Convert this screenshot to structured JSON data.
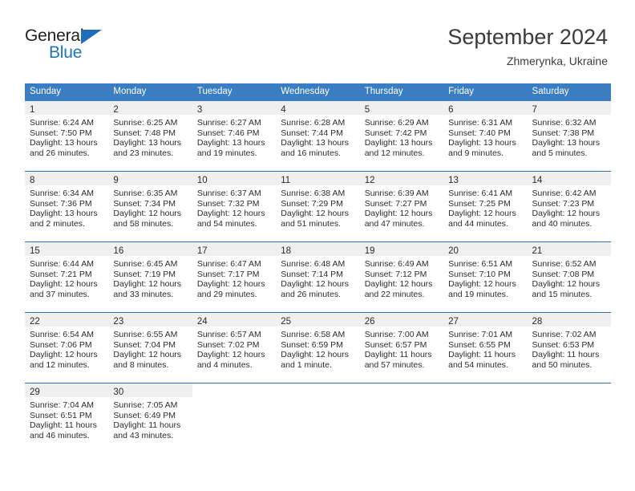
{
  "brand": {
    "name_top": "General",
    "name_bottom": "Blue",
    "accent_color": "#1b75bb",
    "triangle_color": "#1e6fb8"
  },
  "header": {
    "title": "September 2024",
    "subtitle": "Zhmerynka, Ukraine"
  },
  "calendar": {
    "header_bg": "#3a7dc2",
    "row_divider_color": "#2f6fb4",
    "day_band_bg": "#efefef",
    "weekdays": [
      "Sunday",
      "Monday",
      "Tuesday",
      "Wednesday",
      "Thursday",
      "Friday",
      "Saturday"
    ],
    "weeks": [
      [
        {
          "day": "1",
          "sunrise": "Sunrise: 6:24 AM",
          "sunset": "Sunset: 7:50 PM",
          "daylight1": "Daylight: 13 hours",
          "daylight2": "and 26 minutes."
        },
        {
          "day": "2",
          "sunrise": "Sunrise: 6:25 AM",
          "sunset": "Sunset: 7:48 PM",
          "daylight1": "Daylight: 13 hours",
          "daylight2": "and 23 minutes."
        },
        {
          "day": "3",
          "sunrise": "Sunrise: 6:27 AM",
          "sunset": "Sunset: 7:46 PM",
          "daylight1": "Daylight: 13 hours",
          "daylight2": "and 19 minutes."
        },
        {
          "day": "4",
          "sunrise": "Sunrise: 6:28 AM",
          "sunset": "Sunset: 7:44 PM",
          "daylight1": "Daylight: 13 hours",
          "daylight2": "and 16 minutes."
        },
        {
          "day": "5",
          "sunrise": "Sunrise: 6:29 AM",
          "sunset": "Sunset: 7:42 PM",
          "daylight1": "Daylight: 13 hours",
          "daylight2": "and 12 minutes."
        },
        {
          "day": "6",
          "sunrise": "Sunrise: 6:31 AM",
          "sunset": "Sunset: 7:40 PM",
          "daylight1": "Daylight: 13 hours",
          "daylight2": "and 9 minutes."
        },
        {
          "day": "7",
          "sunrise": "Sunrise: 6:32 AM",
          "sunset": "Sunset: 7:38 PM",
          "daylight1": "Daylight: 13 hours",
          "daylight2": "and 5 minutes."
        }
      ],
      [
        {
          "day": "8",
          "sunrise": "Sunrise: 6:34 AM",
          "sunset": "Sunset: 7:36 PM",
          "daylight1": "Daylight: 13 hours",
          "daylight2": "and 2 minutes."
        },
        {
          "day": "9",
          "sunrise": "Sunrise: 6:35 AM",
          "sunset": "Sunset: 7:34 PM",
          "daylight1": "Daylight: 12 hours",
          "daylight2": "and 58 minutes."
        },
        {
          "day": "10",
          "sunrise": "Sunrise: 6:37 AM",
          "sunset": "Sunset: 7:32 PM",
          "daylight1": "Daylight: 12 hours",
          "daylight2": "and 54 minutes."
        },
        {
          "day": "11",
          "sunrise": "Sunrise: 6:38 AM",
          "sunset": "Sunset: 7:29 PM",
          "daylight1": "Daylight: 12 hours",
          "daylight2": "and 51 minutes."
        },
        {
          "day": "12",
          "sunrise": "Sunrise: 6:39 AM",
          "sunset": "Sunset: 7:27 PM",
          "daylight1": "Daylight: 12 hours",
          "daylight2": "and 47 minutes."
        },
        {
          "day": "13",
          "sunrise": "Sunrise: 6:41 AM",
          "sunset": "Sunset: 7:25 PM",
          "daylight1": "Daylight: 12 hours",
          "daylight2": "and 44 minutes."
        },
        {
          "day": "14",
          "sunrise": "Sunrise: 6:42 AM",
          "sunset": "Sunset: 7:23 PM",
          "daylight1": "Daylight: 12 hours",
          "daylight2": "and 40 minutes."
        }
      ],
      [
        {
          "day": "15",
          "sunrise": "Sunrise: 6:44 AM",
          "sunset": "Sunset: 7:21 PM",
          "daylight1": "Daylight: 12 hours",
          "daylight2": "and 37 minutes."
        },
        {
          "day": "16",
          "sunrise": "Sunrise: 6:45 AM",
          "sunset": "Sunset: 7:19 PM",
          "daylight1": "Daylight: 12 hours",
          "daylight2": "and 33 minutes."
        },
        {
          "day": "17",
          "sunrise": "Sunrise: 6:47 AM",
          "sunset": "Sunset: 7:17 PM",
          "daylight1": "Daylight: 12 hours",
          "daylight2": "and 29 minutes."
        },
        {
          "day": "18",
          "sunrise": "Sunrise: 6:48 AM",
          "sunset": "Sunset: 7:14 PM",
          "daylight1": "Daylight: 12 hours",
          "daylight2": "and 26 minutes."
        },
        {
          "day": "19",
          "sunrise": "Sunrise: 6:49 AM",
          "sunset": "Sunset: 7:12 PM",
          "daylight1": "Daylight: 12 hours",
          "daylight2": "and 22 minutes."
        },
        {
          "day": "20",
          "sunrise": "Sunrise: 6:51 AM",
          "sunset": "Sunset: 7:10 PM",
          "daylight1": "Daylight: 12 hours",
          "daylight2": "and 19 minutes."
        },
        {
          "day": "21",
          "sunrise": "Sunrise: 6:52 AM",
          "sunset": "Sunset: 7:08 PM",
          "daylight1": "Daylight: 12 hours",
          "daylight2": "and 15 minutes."
        }
      ],
      [
        {
          "day": "22",
          "sunrise": "Sunrise: 6:54 AM",
          "sunset": "Sunset: 7:06 PM",
          "daylight1": "Daylight: 12 hours",
          "daylight2": "and 12 minutes."
        },
        {
          "day": "23",
          "sunrise": "Sunrise: 6:55 AM",
          "sunset": "Sunset: 7:04 PM",
          "daylight1": "Daylight: 12 hours",
          "daylight2": "and 8 minutes."
        },
        {
          "day": "24",
          "sunrise": "Sunrise: 6:57 AM",
          "sunset": "Sunset: 7:02 PM",
          "daylight1": "Daylight: 12 hours",
          "daylight2": "and 4 minutes."
        },
        {
          "day": "25",
          "sunrise": "Sunrise: 6:58 AM",
          "sunset": "Sunset: 6:59 PM",
          "daylight1": "Daylight: 12 hours",
          "daylight2": "and 1 minute."
        },
        {
          "day": "26",
          "sunrise": "Sunrise: 7:00 AM",
          "sunset": "Sunset: 6:57 PM",
          "daylight1": "Daylight: 11 hours",
          "daylight2": "and 57 minutes."
        },
        {
          "day": "27",
          "sunrise": "Sunrise: 7:01 AM",
          "sunset": "Sunset: 6:55 PM",
          "daylight1": "Daylight: 11 hours",
          "daylight2": "and 54 minutes."
        },
        {
          "day": "28",
          "sunrise": "Sunrise: 7:02 AM",
          "sunset": "Sunset: 6:53 PM",
          "daylight1": "Daylight: 11 hours",
          "daylight2": "and 50 minutes."
        }
      ],
      [
        {
          "day": "29",
          "sunrise": "Sunrise: 7:04 AM",
          "sunset": "Sunset: 6:51 PM",
          "daylight1": "Daylight: 11 hours",
          "daylight2": "and 46 minutes."
        },
        {
          "day": "30",
          "sunrise": "Sunrise: 7:05 AM",
          "sunset": "Sunset: 6:49 PM",
          "daylight1": "Daylight: 11 hours",
          "daylight2": "and 43 minutes."
        },
        {
          "day": "",
          "sunrise": "",
          "sunset": "",
          "daylight1": "",
          "daylight2": ""
        },
        {
          "day": "",
          "sunrise": "",
          "sunset": "",
          "daylight1": "",
          "daylight2": ""
        },
        {
          "day": "",
          "sunrise": "",
          "sunset": "",
          "daylight1": "",
          "daylight2": ""
        },
        {
          "day": "",
          "sunrise": "",
          "sunset": "",
          "daylight1": "",
          "daylight2": ""
        },
        {
          "day": "",
          "sunrise": "",
          "sunset": "",
          "daylight1": "",
          "daylight2": ""
        }
      ]
    ]
  }
}
